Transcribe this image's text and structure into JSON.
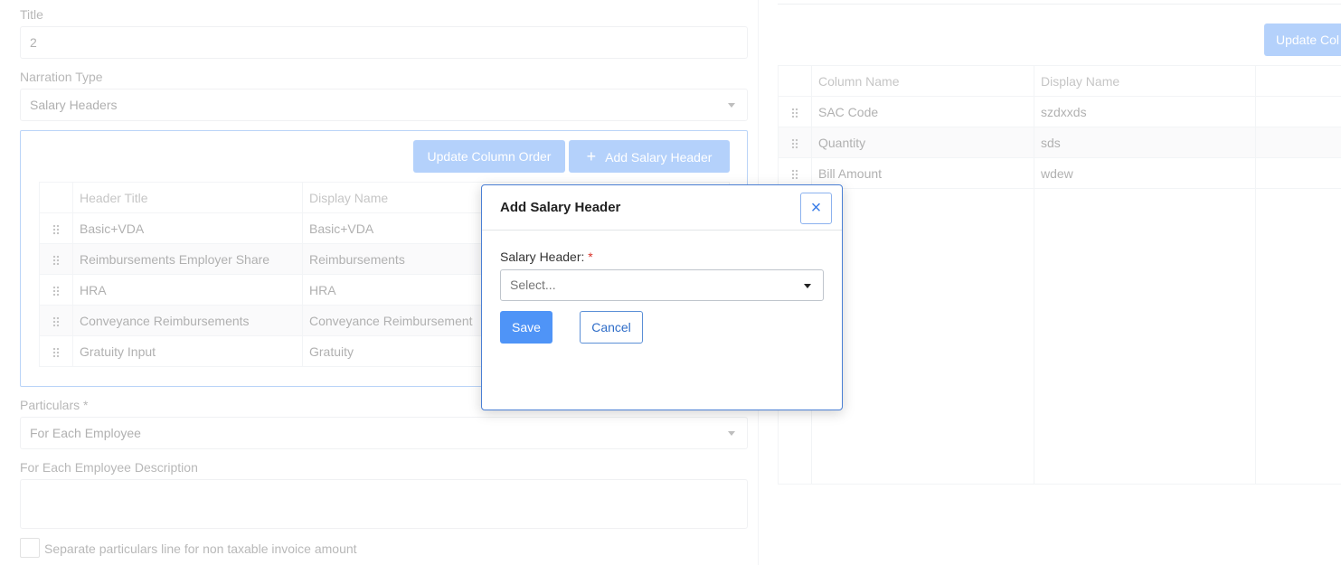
{
  "form": {
    "title_label": "Title",
    "title_value": "2",
    "narration_type_label": "Narration Type",
    "narration_type_value": "Salary Headers",
    "particulars_label": "Particulars *",
    "particulars_value": "For Each Employee",
    "description_label": "For Each Employee Description",
    "description_value": "",
    "checkbox_label": "Separate particulars line for non taxable invoice amount"
  },
  "salary_box": {
    "update_order_label": "Update Column Order",
    "add_header_label": "Add Salary Header",
    "add_icon": "+",
    "columns": [
      "Header Title",
      "Display Name"
    ],
    "rows": [
      [
        "Basic+VDA",
        "Basic+VDA"
      ],
      [
        "Reimbursements Employer Share",
        "Reimbursements"
      ],
      [
        "HRA",
        "HRA"
      ],
      [
        "Conveyance Reimbursements",
        "Conveyance Reimbursement"
      ],
      [
        "Gratuity Input",
        "Gratuity"
      ]
    ]
  },
  "right_panel": {
    "update_button_label": "Update Col",
    "columns": [
      "Column Name",
      "Display Name"
    ],
    "rows": [
      [
        "SAC Code",
        "szdxxds"
      ],
      [
        "Quantity",
        "sds"
      ],
      [
        "Bill Amount",
        "wdew"
      ]
    ]
  },
  "modal": {
    "title": "Add Salary Header",
    "close_icon": "×",
    "field_label": "Salary Header:",
    "required_mark": "*",
    "select_placeholder": "Select...",
    "save_label": "Save",
    "cancel_label": "Cancel"
  },
  "colors": {
    "primary": "#4f94f7",
    "modal_border": "#4a7fd4",
    "required": "#d9342b"
  }
}
